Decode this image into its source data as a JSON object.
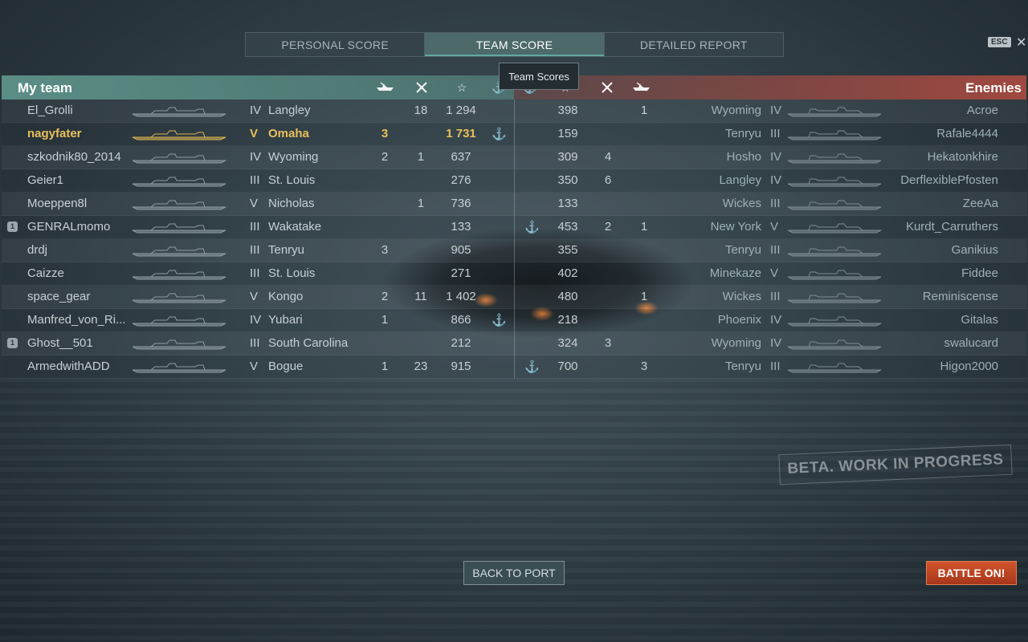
{
  "tabs": [
    {
      "label": "PERSONAL SCORE",
      "active": false
    },
    {
      "label": "TEAM SCORE",
      "active": true
    },
    {
      "label": "DETAILED REPORT",
      "active": false
    }
  ],
  "esc_label": "ESC",
  "tooltip": "Team Scores",
  "my_team": {
    "title": "My team",
    "columns": [
      "ships-destroyed-icon",
      "planes-destroyed-icon",
      "star-icon",
      "anchor-icon"
    ],
    "players": [
      {
        "name": "El_Grolli",
        "tier": "IV",
        "ship": "Langley",
        "kills": "",
        "planes": "18",
        "score": "1 294",
        "anchor": false,
        "badge": "",
        "me": false
      },
      {
        "name": "nagyfater",
        "tier": "V",
        "ship": "Omaha",
        "kills": "3",
        "planes": "",
        "score": "1 731",
        "anchor": true,
        "badge": "",
        "me": true
      },
      {
        "name": "szkodnik80_2014",
        "tier": "IV",
        "ship": "Wyoming",
        "kills": "2",
        "planes": "1",
        "score": "637",
        "anchor": false,
        "badge": "",
        "me": false
      },
      {
        "name": "Geier1",
        "tier": "III",
        "ship": "St. Louis",
        "kills": "",
        "planes": "",
        "score": "276",
        "anchor": false,
        "badge": "",
        "me": false
      },
      {
        "name": "Moeppen8l",
        "tier": "V",
        "ship": "Nicholas",
        "kills": "",
        "planes": "1",
        "score": "736",
        "anchor": false,
        "badge": "",
        "me": false
      },
      {
        "name": "GENRALmomo",
        "tier": "III",
        "ship": "Wakatake",
        "kills": "",
        "planes": "",
        "score": "133",
        "anchor": false,
        "badge": "1",
        "me": false
      },
      {
        "name": "drdj",
        "tier": "III",
        "ship": "Tenryu",
        "kills": "3",
        "planes": "",
        "score": "905",
        "anchor": false,
        "badge": "",
        "me": false
      },
      {
        "name": "Caizze",
        "tier": "III",
        "ship": "St. Louis",
        "kills": "",
        "planes": "",
        "score": "271",
        "anchor": false,
        "badge": "",
        "me": false
      },
      {
        "name": "space_gear",
        "tier": "V",
        "ship": "Kongo",
        "kills": "2",
        "planes": "11",
        "score": "1 402",
        "anchor": false,
        "badge": "",
        "me": false
      },
      {
        "name": "Manfred_von_Ri...",
        "tier": "IV",
        "ship": "Yubari",
        "kills": "1",
        "planes": "",
        "score": "866",
        "anchor": true,
        "badge": "",
        "me": false
      },
      {
        "name": "Ghost__501",
        "tier": "III",
        "ship": "South Carolina",
        "kills": "",
        "planes": "",
        "score": "212",
        "anchor": false,
        "badge": "1",
        "me": false
      },
      {
        "name": "ArmedwithADD",
        "tier": "V",
        "ship": "Bogue",
        "kills": "1",
        "planes": "23",
        "score": "915",
        "anchor": false,
        "badge": "",
        "me": false
      }
    ]
  },
  "enemies": {
    "title": "Enemies",
    "columns": [
      "anchor-icon",
      "star-icon",
      "planes-destroyed-icon",
      "ships-destroyed-icon"
    ],
    "players": [
      {
        "name": "Acroe",
        "tier": "IV",
        "ship": "Wyoming",
        "anchor": false,
        "score": "398",
        "planes": "",
        "kills": "1"
      },
      {
        "name": "Rafale4444",
        "tier": "III",
        "ship": "Tenryu",
        "anchor": false,
        "score": "159",
        "planes": "",
        "kills": ""
      },
      {
        "name": "Hekatonkhire",
        "tier": "IV",
        "ship": "Hosho",
        "anchor": false,
        "score": "309",
        "planes": "4",
        "kills": ""
      },
      {
        "name": "DerflexiblePfosten",
        "tier": "IV",
        "ship": "Langley",
        "anchor": false,
        "score": "350",
        "planes": "6",
        "kills": ""
      },
      {
        "name": "ZeeAa",
        "tier": "III",
        "ship": "Wickes",
        "anchor": false,
        "score": "133",
        "planes": "",
        "kills": ""
      },
      {
        "name": "Kurdt_Carruthers",
        "tier": "V",
        "ship": "New York",
        "anchor": true,
        "score": "453",
        "planes": "2",
        "kills": "1"
      },
      {
        "name": "Ganikius",
        "tier": "III",
        "ship": "Tenryu",
        "anchor": false,
        "score": "355",
        "planes": "",
        "kills": ""
      },
      {
        "name": "Fiddee",
        "tier": "V",
        "ship": "Minekaze",
        "anchor": false,
        "score": "402",
        "planes": "",
        "kills": ""
      },
      {
        "name": "Reminiscense",
        "tier": "III",
        "ship": "Wickes",
        "anchor": false,
        "score": "480",
        "planes": "",
        "kills": "1"
      },
      {
        "name": "Gitalas",
        "tier": "IV",
        "ship": "Phoenix",
        "anchor": false,
        "score": "218",
        "planes": "",
        "kills": ""
      },
      {
        "name": "swalucard",
        "tier": "IV",
        "ship": "Wyoming",
        "anchor": false,
        "score": "324",
        "planes": "3",
        "kills": ""
      },
      {
        "name": "Higon2000",
        "tier": "III",
        "ship": "Tenryu",
        "anchor": true,
        "score": "700",
        "planes": "",
        "kills": "3"
      }
    ]
  },
  "buttons": {
    "back_to_port": "BACK TO PORT",
    "battle_on": "BATTLE ON!"
  },
  "watermark": "BETA. WORK IN PROGRESS",
  "colors": {
    "my_team_header": "#5f968c",
    "enemy_header": "#aa4b41",
    "self_highlight": "#e8c05a",
    "battle_button": "#c2462a"
  }
}
